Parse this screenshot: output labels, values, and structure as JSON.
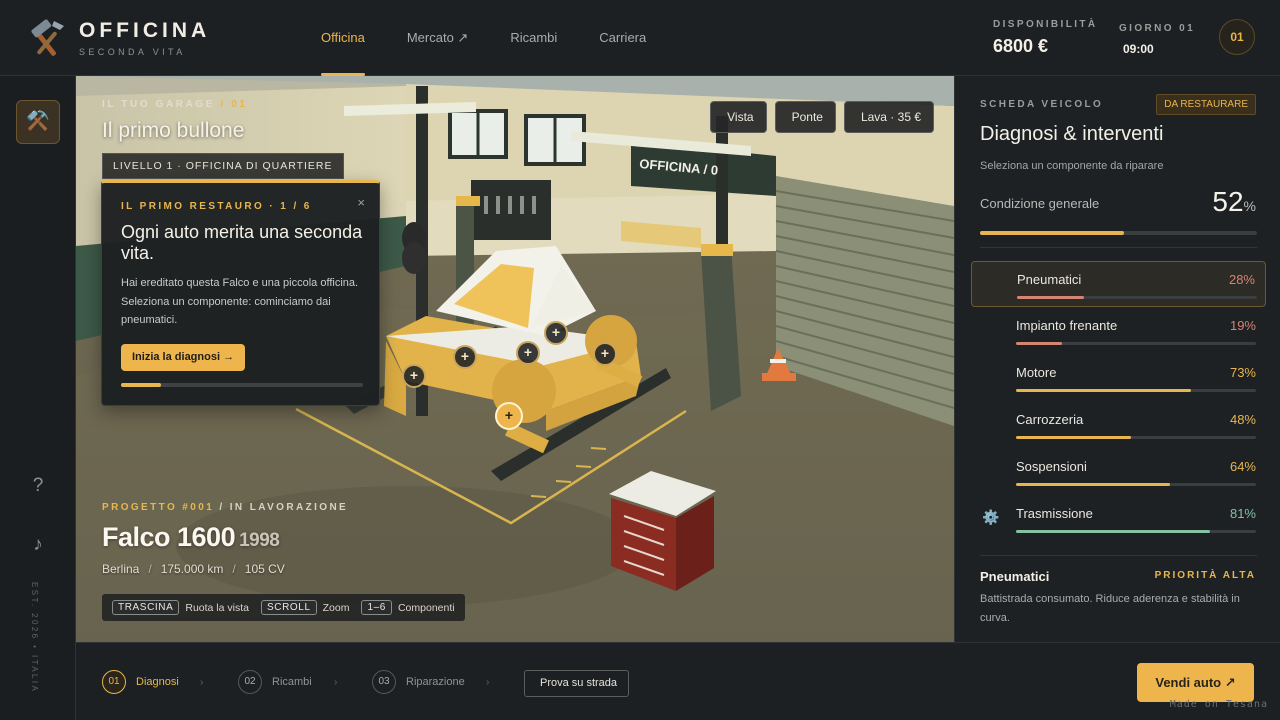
{
  "brand": {
    "title": "OFFICINA",
    "subtitle": "SECONDA VITA"
  },
  "nav": [
    {
      "label": "Officina"
    },
    {
      "label": "Mercato ↗"
    },
    {
      "label": "Ricambi"
    },
    {
      "label": "Carriera"
    }
  ],
  "stats": {
    "availability_label": "DISPONIBILITÀ",
    "availability_value": "6800 €",
    "day_label": "GIORNO 01",
    "time_value": "09:00",
    "day_badge": "01"
  },
  "sidebar": {
    "items": [
      {
        "icon": "hammer-pick-icon",
        "glyph": "⚒️"
      },
      {
        "icon": "car-icon",
        "glyph": ""
      },
      {
        "icon": "document-icon",
        "glyph": ""
      },
      {
        "icon": "box-icon",
        "glyph": ""
      },
      {
        "icon": "chart-icon",
        "glyph": ""
      }
    ],
    "help_glyph": "?",
    "music_glyph": "♪",
    "vertical_text": "EST. 2026 • ITALIA"
  },
  "scene": {
    "eyebrow": "IL TUO GARAGE",
    "eyebrow_number": "/ 01",
    "title": "Il primo bullone",
    "level": "LIVELLO 1 · OFFICINA DI QUARTIERE",
    "wall_sign": "OFFICINA / 0",
    "tools": [
      {
        "icon": "eye-icon",
        "label": "Vista"
      },
      {
        "icon": "lift-icon",
        "label": "Ponte"
      },
      {
        "icon": "water-drop-icon",
        "label": "Lava · 35 €"
      }
    ],
    "hotspot_glyph": "+"
  },
  "tutorial": {
    "step": "IL PRIMO RESTAURO · 1 / 6",
    "close": "×",
    "title": "Ogni auto merita una seconda vita.",
    "body": "Hai ereditato questa Falco e una piccola officina. Seleziona un componente: cominciamo dai pneumatici.",
    "button": "Inizia la diagnosi →",
    "progress": 0.167
  },
  "project": {
    "eyebrow": "PROGETTO #001",
    "eyebrow_status": "/ IN LAVORAZIONE",
    "name": "Falco 1600",
    "year": "1998",
    "type": "Berlina",
    "km": "175.000 km",
    "power": "105 CV",
    "sep": "/"
  },
  "controls": [
    {
      "key": "TRASCINA",
      "label": "Ruota la vista"
    },
    {
      "key": "SCROLL",
      "label": "Zoom"
    },
    {
      "key": "1–6",
      "label": "Componenti"
    }
  ],
  "panel": {
    "eyebrow": "SCHEDA VEICOLO",
    "badge": "DA RESTAURARE",
    "title": "Diagnosi & interventi",
    "subtitle": "Seleziona un componente da riparare",
    "condition_label": "Condizione generale",
    "condition_value": "52",
    "condition_unit": "%",
    "condition": 0.52,
    "components": [
      {
        "name": "Pneumatici",
        "percent": "28%",
        "value": 0.28,
        "color": "#d58573",
        "icon": "tire-icon",
        "glyph": ""
      },
      {
        "name": "Impianto frenante",
        "percent": "19%",
        "value": 0.19,
        "color": "#d58573",
        "icon": "brake-icon",
        "glyph": ""
      },
      {
        "name": "Motore",
        "percent": "73%",
        "value": 0.73,
        "color": "#e8b64e",
        "icon": "engine-icon",
        "glyph": ""
      },
      {
        "name": "Carrozzeria",
        "percent": "48%",
        "value": 0.48,
        "color": "#e8b64e",
        "icon": "car-body-icon",
        "glyph": ""
      },
      {
        "name": "Sospensioni",
        "percent": "64%",
        "value": 0.64,
        "color": "#e8b64e",
        "icon": "spring-icon",
        "glyph": ""
      },
      {
        "name": "Trasmissione",
        "percent": "81%",
        "value": 0.81,
        "color": "#86c1a4",
        "icon": "gear-icon",
        "glyph": "⚙️"
      }
    ],
    "detail_title": "Pneumatici",
    "detail_priority": "PRIORITÀ ALTA",
    "detail_body": "Battistrada consumato. Riduce aderenza e stabilità in curva."
  },
  "steps": [
    {
      "num": "01",
      "label": "Diagnosi"
    },
    {
      "num": "02",
      "label": "Ricambi"
    },
    {
      "num": "03",
      "label": "Riparazione"
    }
  ],
  "step_arrow": "›",
  "road_button": "Prova su strada",
  "sell_button": "Vendi auto ↗",
  "made_with": "Made on Tesana",
  "colors": {
    "accent": "#e8b64e",
    "danger": "#d58573",
    "good": "#86c1a4",
    "background": "#1b1e21"
  }
}
